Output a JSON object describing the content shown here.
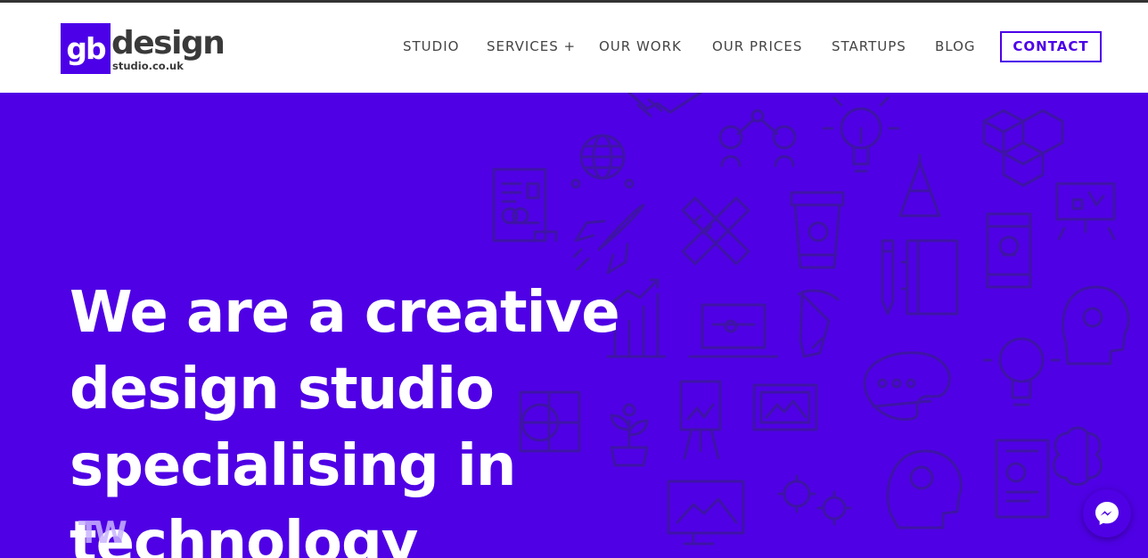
{
  "brand": {
    "logo_mark": "gb",
    "logo_word": "design",
    "logo_sub": "studio.co.uk",
    "accent_color": "#4f00e5"
  },
  "nav": {
    "items": [
      {
        "label": "STUDIO"
      },
      {
        "label": "SERVICES +"
      },
      {
        "label": "OUR WORK"
      },
      {
        "label": "OUR PRICES"
      },
      {
        "label": "STARTUPS"
      },
      {
        "label": "BLOG"
      }
    ],
    "contact_label": "CONTACT"
  },
  "hero": {
    "lines": [
      "We are a creative",
      "design studio",
      "specialising in",
      "technology"
    ],
    "typing_overlay": "TW",
    "background_icons": [
      "globe-icon",
      "handshake-icon",
      "network-icon",
      "lightbulb-icon",
      "cubes-icon",
      "document-icon",
      "rocket-icon",
      "pencil-ruler-icon",
      "coffee-cup-icon",
      "pencil-icon",
      "notebook-icon",
      "smartphone-icon",
      "presentation-icon",
      "graph-icon",
      "laptop-icon",
      "pen-nib-icon",
      "head-question-icon",
      "brain-bulb-icon",
      "palette-icon",
      "easel-icon",
      "picture-icon",
      "plant-icon",
      "monitor-icon",
      "gears-icon",
      "head-gear-icon",
      "tablet-icon",
      "brain-icon"
    ]
  },
  "chat": {
    "icon": "messenger-icon"
  }
}
